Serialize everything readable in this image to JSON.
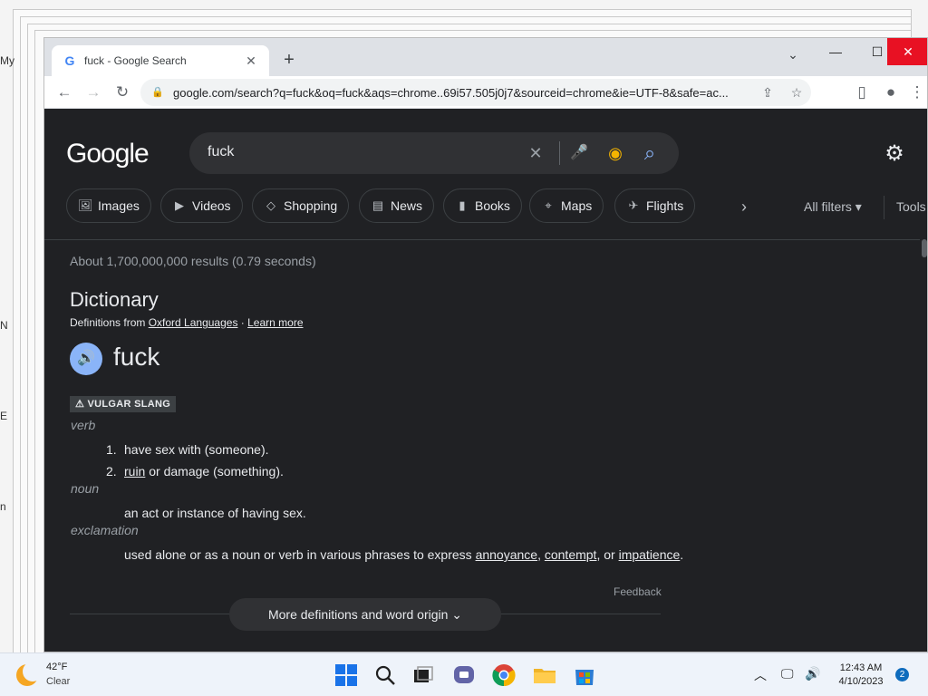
{
  "desktop": {
    "fragments": [
      "My",
      "N",
      "E",
      "n"
    ]
  },
  "tab": {
    "favicon": "G",
    "title": "fuck - Google Search",
    "close": "✕"
  },
  "newtab": "+",
  "window": {
    "tab_search": "⌄",
    "minimize": "—",
    "maximize": "☐",
    "close": "✕"
  },
  "toolbar": {
    "back": "←",
    "forward": "→",
    "reload": "↻",
    "url": "google.com/search?q=fuck&oq=fuck&aqs=chrome..69i57.505j0j7&sourceid=chrome&ie=UTF-8&safe=ac...",
    "share": "⇪",
    "bookmark": "☆",
    "sidepanel": "▯",
    "profile": "●",
    "menu": "⋮"
  },
  "search": {
    "logo": "Google",
    "query": "fuck",
    "clear": "✕",
    "mic": "🎤",
    "lens": "◉",
    "submit": "⌕",
    "settings": "⚙"
  },
  "chips": [
    {
      "icon": "🖼",
      "label": "Images"
    },
    {
      "icon": "▶",
      "label": "Videos"
    },
    {
      "icon": "◇",
      "label": "Shopping"
    },
    {
      "icon": "▤",
      "label": "News"
    },
    {
      "icon": "▮",
      "label": "Books"
    },
    {
      "icon": "⌖",
      "label": "Maps"
    },
    {
      "icon": "✈",
      "label": "Flights"
    }
  ],
  "chip_next": "›",
  "filters": {
    "all_filters": "All filters ▾",
    "tools": "Tools"
  },
  "results": {
    "stats": "About 1,700,000,000 results (0.79 seconds)"
  },
  "dictionary": {
    "title": "Dictionary",
    "source_prefix": "Definitions from ",
    "source_link": "Oxford Languages",
    "source_sep": " · ",
    "learn_more": "Learn more",
    "speaker": "🔊",
    "word": "fuck",
    "label": "⚠ VULGAR SLANG",
    "verb": {
      "pos": "verb",
      "defs": [
        {
          "num": "1.",
          "text": "have sex with (someone)."
        },
        {
          "num": "2.",
          "link": "ruin",
          "text": " or damage (something)."
        }
      ]
    },
    "noun": {
      "pos": "noun",
      "def": "an act or instance of having sex."
    },
    "exclamation": {
      "pos": "exclamation",
      "def_prefix": "used alone or as a noun or verb in various phrases to express ",
      "link1": "annoyance",
      "sep1": ", ",
      "link2": "contempt",
      "sep2": ", or ",
      "link3": "impatience",
      "suffix": "."
    },
    "feedback": "Feedback",
    "more": "More definitions and word origin ⌄"
  },
  "taskbar": {
    "weather_temp": "42°F",
    "weather_desc": "Clear",
    "tray_chevron": "︿",
    "tray_network": "🖵",
    "tray_volume": "🔊",
    "time": "12:43 AM",
    "date": "4/10/2023",
    "notifications": "2"
  },
  "colors": {
    "accent": "#8ab4f8",
    "page_bg": "#202124",
    "close_red": "#e81123"
  }
}
